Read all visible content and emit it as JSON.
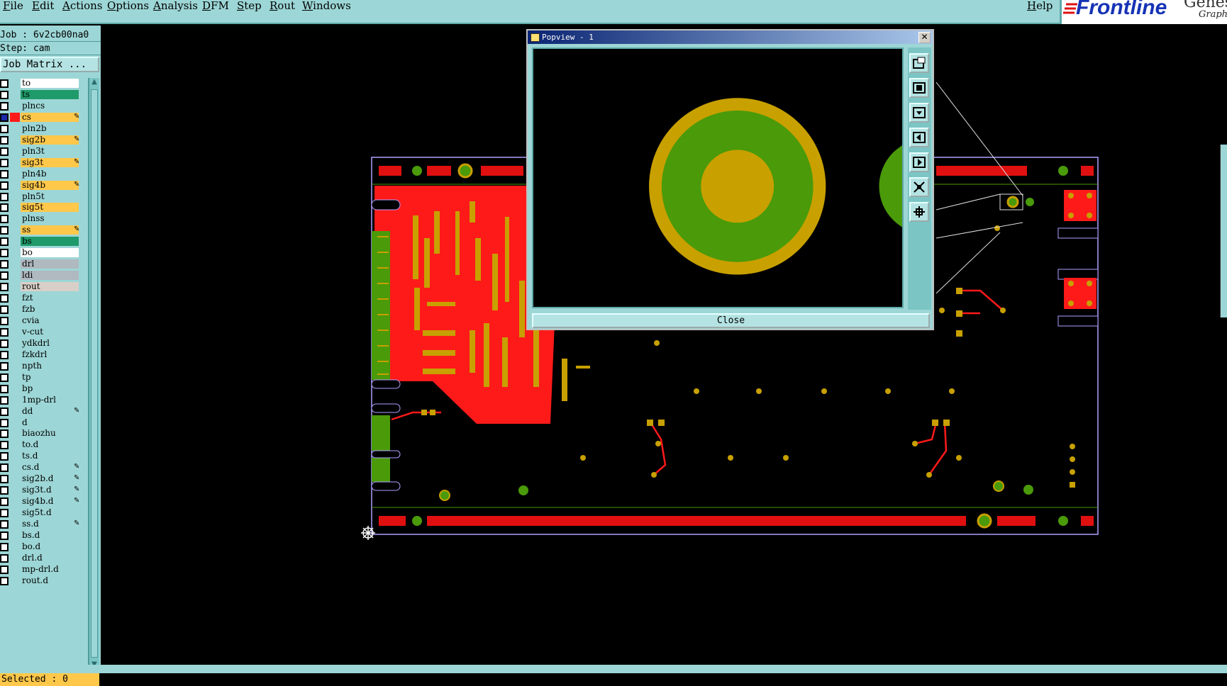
{
  "menubar": {
    "items": [
      "File",
      "Edit",
      "Actions",
      "Options",
      "Analysis",
      "DFM",
      "Step",
      "Rout",
      "Windows"
    ],
    "help": "Help"
  },
  "logo": {
    "brand": "Frontline",
    "product": "Genesis",
    "subtitle": "Graphi"
  },
  "left_panel": {
    "job": "Job : 6v2cb00na0",
    "step": "Step: cam",
    "matrix_button": "Job Matrix ...",
    "selected": "Selected : 0",
    "layers": [
      {
        "name": "to",
        "color": "#ffffff",
        "edit": false
      },
      {
        "name": "ts",
        "color": "#1f9a6a",
        "edit": false
      },
      {
        "name": "plncs",
        "color": "#9dd6d6",
        "edit": false
      },
      {
        "name": "cs",
        "color": "#ffc84a",
        "edit": true,
        "active": true
      },
      {
        "name": "pln2b",
        "color": "#9dd6d6",
        "edit": false
      },
      {
        "name": "sig2b",
        "color": "#ffc84a",
        "edit": true
      },
      {
        "name": "pln3t",
        "color": "#9dd6d6",
        "edit": false
      },
      {
        "name": "sig3t",
        "color": "#ffc84a",
        "edit": true
      },
      {
        "name": "pln4b",
        "color": "#9dd6d6",
        "edit": false
      },
      {
        "name": "sig4b",
        "color": "#ffc84a",
        "edit": true
      },
      {
        "name": "pln5t",
        "color": "#9dd6d6",
        "edit": false
      },
      {
        "name": "sig5t",
        "color": "#ffc84a",
        "edit": false
      },
      {
        "name": "plnss",
        "color": "#9dd6d6",
        "edit": false
      },
      {
        "name": "ss",
        "color": "#ffc84a",
        "edit": true
      },
      {
        "name": "bs",
        "color": "#1f9a6a",
        "edit": false
      },
      {
        "name": "bo",
        "color": "#ffffff",
        "edit": false
      },
      {
        "name": "drl",
        "color": "#b0b8c0",
        "edit": false
      },
      {
        "name": "ldi",
        "color": "#b0b8c0",
        "edit": false
      },
      {
        "name": "rout",
        "color": "#d8d0c8",
        "edit": false
      },
      {
        "name": "fzt",
        "color": "#9dd6d6",
        "edit": false
      },
      {
        "name": "fzb",
        "color": "#9dd6d6",
        "edit": false
      },
      {
        "name": "cvia",
        "color": "#9dd6d6",
        "edit": false
      },
      {
        "name": "v-cut",
        "color": "#9dd6d6",
        "edit": false
      },
      {
        "name": "ydkdrl",
        "color": "#9dd6d6",
        "edit": false
      },
      {
        "name": "fzkdrl",
        "color": "#9dd6d6",
        "edit": false
      },
      {
        "name": "npth",
        "color": "#9dd6d6",
        "edit": false
      },
      {
        "name": "tp",
        "color": "#9dd6d6",
        "edit": false
      },
      {
        "name": "bp",
        "color": "#9dd6d6",
        "edit": false
      },
      {
        "name": "1mp-drl",
        "color": "#9dd6d6",
        "edit": false
      },
      {
        "name": "dd",
        "color": "#9dd6d6",
        "edit": true
      },
      {
        "name": "d",
        "color": "#9dd6d6",
        "edit": false
      },
      {
        "name": "biaozhu",
        "color": "#9dd6d6",
        "edit": false
      },
      {
        "name": "to.d",
        "color": "#9dd6d6",
        "edit": false
      },
      {
        "name": "ts.d",
        "color": "#9dd6d6",
        "edit": false
      },
      {
        "name": "cs.d",
        "color": "#9dd6d6",
        "edit": true
      },
      {
        "name": "sig2b.d",
        "color": "#9dd6d6",
        "edit": true
      },
      {
        "name": "sig3t.d",
        "color": "#9dd6d6",
        "edit": true
      },
      {
        "name": "sig4b.d",
        "color": "#9dd6d6",
        "edit": true
      },
      {
        "name": "sig5t.d",
        "color": "#9dd6d6",
        "edit": false
      },
      {
        "name": "ss.d",
        "color": "#9dd6d6",
        "edit": true
      },
      {
        "name": "bs.d",
        "color": "#9dd6d6",
        "edit": false
      },
      {
        "name": "bo.d",
        "color": "#9dd6d6",
        "edit": false
      },
      {
        "name": "drl.d",
        "color": "#9dd6d6",
        "edit": false
      },
      {
        "name": "mp-drl.d",
        "color": "#9dd6d6",
        "edit": false
      },
      {
        "name": "rout.d",
        "color": "#9dd6d6",
        "edit": false
      }
    ]
  },
  "popview": {
    "title": "Popview - 1",
    "close_label": "Close",
    "tools": [
      "zoom-window-icon",
      "zoom-in-icon",
      "zoom-out-icon",
      "pan-left-icon",
      "pan-right-icon",
      "fit-icon",
      "home-icon"
    ]
  },
  "colors": {
    "panel": "#9dd6d6",
    "copper_red": "#ff1a1a",
    "pad_gold": "#c8a000",
    "mask_green": "#4a9a0a",
    "outline": "#b0a0ff"
  }
}
